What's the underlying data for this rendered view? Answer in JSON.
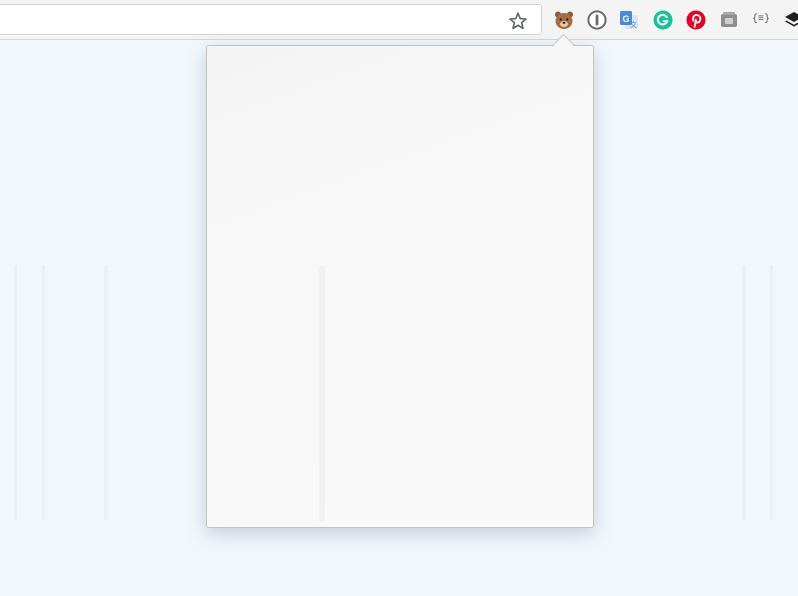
{
  "omnibox": {
    "value": "",
    "placeholder": ""
  },
  "toolbar": {
    "bookmark_icon": "star-icon",
    "extensions": [
      {
        "name": "bear-extension",
        "icon": "bear-icon"
      },
      {
        "name": "1password-extension",
        "icon": "1password-icon"
      },
      {
        "name": "google-translate-extension",
        "icon": "google-translate-icon"
      },
      {
        "name": "grammarly-extension",
        "icon": "grammarly-icon"
      },
      {
        "name": "pinterest-extension",
        "icon": "pinterest-icon"
      },
      {
        "name": "storage-extension",
        "icon": "storage-icon"
      },
      {
        "name": "json-formatter-extension",
        "icon": "json-icon",
        "label": "{≡}"
      },
      {
        "name": "layers-extension",
        "icon": "layers-icon"
      }
    ]
  },
  "popup": {
    "state": "open-empty"
  },
  "colors": {
    "page_background": "#f1f7fd",
    "toolbar_background": "#f4f4f4",
    "popup_background": "#f7f7f7",
    "grammarly_green": "#15c39a",
    "pinterest_red": "#e60023",
    "google_blue": "#4a89dc"
  }
}
